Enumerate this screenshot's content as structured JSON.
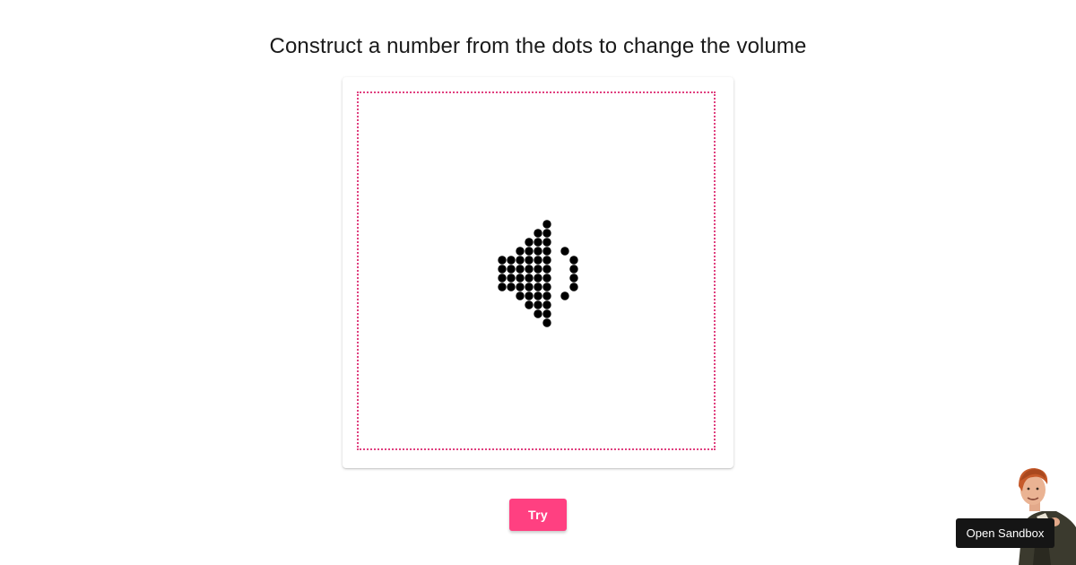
{
  "header": {
    "title": "Construct a number from the dots to change the volume"
  },
  "drop_zone": {
    "border_color": "#e0407f",
    "icon": "speaker-dots-icon",
    "dot_color": "#000000"
  },
  "actions": {
    "try_label": "Try",
    "try_color": "#ff4081"
  },
  "sandbox": {
    "label": "Open Sandbox",
    "mascot_icon": "mascot-figure-icon"
  }
}
